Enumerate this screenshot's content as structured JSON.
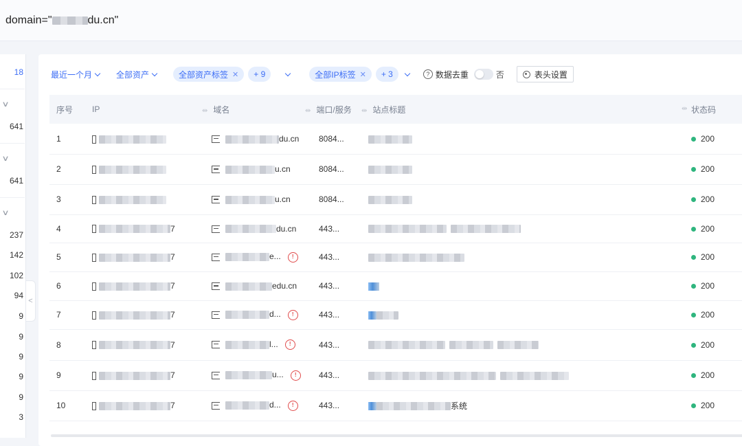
{
  "search": {
    "prefix": "domain=\"",
    "suffix": "du.cn\""
  },
  "left_panel": {
    "first_count": "18",
    "group_counts": [
      "641",
      "641"
    ],
    "list_counts": [
      "237",
      "142",
      "102",
      "94",
      "9",
      "9",
      "9",
      "9",
      "9",
      "3"
    ]
  },
  "toolbar": {
    "time_filter": "最近一个月",
    "asset_filter": "全部资产",
    "asset_tag": "全部资产标签",
    "asset_tag_extra": "+ 9",
    "ip_tag": "全部IP标签",
    "ip_tag_extra": "+ 3",
    "dedupe_label": "数据去重",
    "dedupe_state": "否",
    "header_settings": "表头设置"
  },
  "table": {
    "columns": [
      "序号",
      "IP",
      "域名",
      "端口/服务",
      "站点标题",
      "状态码"
    ],
    "rows": [
      {
        "index": "1",
        "ip_suffix": "",
        "domain_suffix": "du.cn",
        "port": "8084...",
        "status": "200"
      },
      {
        "index": "2",
        "ip_suffix": "",
        "domain_suffix": "u.cn",
        "port": "8084...",
        "status": "200"
      },
      {
        "index": "3",
        "ip_suffix": "",
        "domain_suffix": "u.cn",
        "port": "8084...",
        "status": "200"
      },
      {
        "index": "4",
        "ip_suffix": "7",
        "domain_suffix": "du.cn",
        "port": "443...",
        "status": "200"
      },
      {
        "index": "5",
        "ip_suffix": "7",
        "domain_suffix": "e...",
        "port": "443...",
        "status": "200"
      },
      {
        "index": "6",
        "ip_suffix": "7",
        "domain_suffix": "edu.cn",
        "port": "443...",
        "status": "200"
      },
      {
        "index": "7",
        "ip_suffix": "7",
        "domain_suffix": "d...",
        "port": "443...",
        "status": "200"
      },
      {
        "index": "8",
        "ip_suffix": "7",
        "domain_suffix": "l...",
        "port": "443...",
        "status": "200"
      },
      {
        "index": "9",
        "ip_suffix": "7",
        "domain_suffix": "u...",
        "port": "443...",
        "status": "200"
      },
      {
        "index": "10",
        "ip_suffix": "7",
        "domain_suffix": "d...",
        "port": "443...",
        "status": "200",
        "title_suffix": "系统"
      }
    ]
  },
  "colors": {
    "accent": "#3d6ef5",
    "status_ok": "#2fb57e",
    "shield": "#e04a4a"
  }
}
